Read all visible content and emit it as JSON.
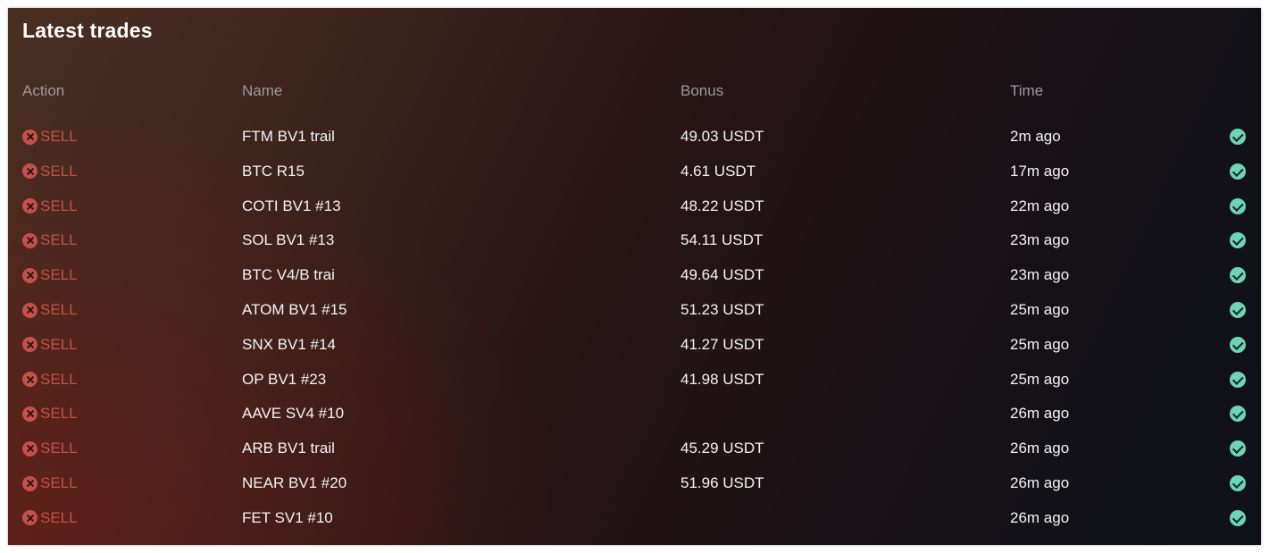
{
  "title": "Latest trades",
  "columns": {
    "action": "Action",
    "name": "Name",
    "bonus": "Bonus",
    "time": "Time"
  },
  "icons": {
    "action": "x-circle-icon",
    "status": "check-circle-icon"
  },
  "colors": {
    "sell": "#c4504a",
    "check": "#6fd3b6",
    "header": "#9a9aa0"
  },
  "trades": [
    {
      "action": "SELL",
      "name": "FTM BV1 trail",
      "bonus": "49.03 USDT",
      "time": "2m ago"
    },
    {
      "action": "SELL",
      "name": "BTC R15",
      "bonus": "4.61 USDT",
      "time": "17m ago"
    },
    {
      "action": "SELL",
      "name": "COTI BV1 #13",
      "bonus": "48.22 USDT",
      "time": "22m ago"
    },
    {
      "action": "SELL",
      "name": "SOL BV1 #13",
      "bonus": "54.11 USDT",
      "time": "23m ago"
    },
    {
      "action": "SELL",
      "name": "BTC V4/B trai",
      "bonus": "49.64 USDT",
      "time": "23m ago"
    },
    {
      "action": "SELL",
      "name": "ATOM BV1 #15",
      "bonus": "51.23 USDT",
      "time": "25m ago"
    },
    {
      "action": "SELL",
      "name": "SNX BV1 #14",
      "bonus": "41.27 USDT",
      "time": "25m ago"
    },
    {
      "action": "SELL",
      "name": "OP BV1 #23",
      "bonus": "41.98 USDT",
      "time": "25m ago"
    },
    {
      "action": "SELL",
      "name": "AAVE SV4 #10",
      "bonus": "",
      "time": "26m ago"
    },
    {
      "action": "SELL",
      "name": "ARB BV1 trail",
      "bonus": "45.29 USDT",
      "time": "26m ago"
    },
    {
      "action": "SELL",
      "name": "NEAR BV1 #20",
      "bonus": "51.96 USDT",
      "time": "26m ago"
    },
    {
      "action": "SELL",
      "name": "FET SV1 #10",
      "bonus": "",
      "time": "26m ago"
    }
  ]
}
